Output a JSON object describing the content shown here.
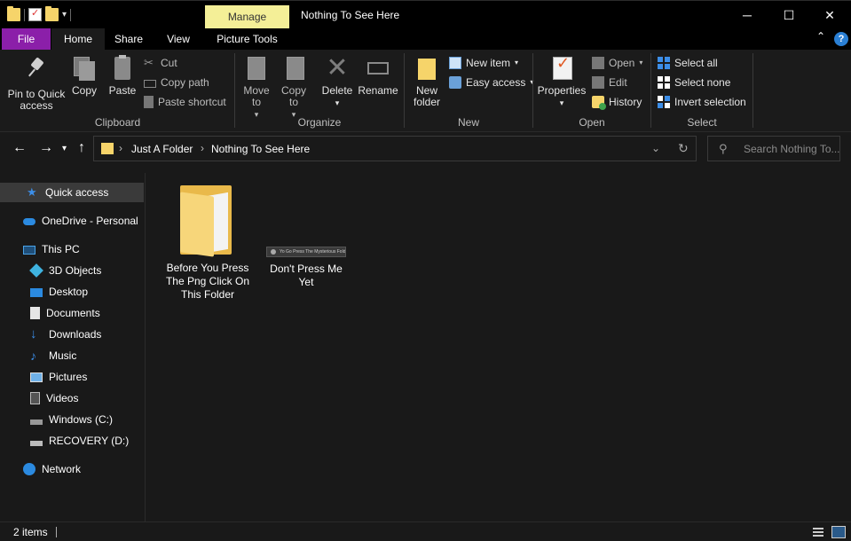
{
  "window": {
    "title": "Nothing To See Here",
    "contextual_tab": "Manage",
    "minimize": "─",
    "maximize": "☐",
    "close": "✕"
  },
  "tabs": {
    "file": "File",
    "home": "Home",
    "share": "Share",
    "view": "View",
    "picture_tools": "Picture Tools",
    "help": "?",
    "collapse": "⌃"
  },
  "ribbon": {
    "clipboard": {
      "label": "Clipboard",
      "pin": "Pin to Quick access",
      "copy": "Copy",
      "paste": "Paste",
      "cut": "Cut",
      "copy_path": "Copy path",
      "paste_shortcut": "Paste shortcut"
    },
    "organize": {
      "label": "Organize",
      "move_to": "Move to",
      "copy_to": "Copy to",
      "delete": "Delete",
      "rename": "Rename"
    },
    "new": {
      "label": "New",
      "new_folder": "New folder",
      "new_item": "New item",
      "easy_access": "Easy access"
    },
    "open": {
      "label": "Open",
      "properties": "Properties",
      "open": "Open",
      "edit": "Edit",
      "history": "History"
    },
    "select": {
      "label": "Select",
      "select_all": "Select all",
      "select_none": "Select none",
      "invert_selection": "Invert selection"
    }
  },
  "address": {
    "crumbs": [
      "Just A Folder",
      "Nothing To See Here"
    ],
    "search_placeholder": "Search Nothing To..."
  },
  "nav": {
    "quick_access": "Quick access",
    "onedrive": "OneDrive - Personal",
    "this_pc": "This PC",
    "objects3d": "3D Objects",
    "desktop": "Desktop",
    "documents": "Documents",
    "downloads": "Downloads",
    "music": "Music",
    "pictures": "Pictures",
    "videos": "Videos",
    "windows_c": "Windows (C:)",
    "recovery_d": "RECOVERY (D:)",
    "network": "Network"
  },
  "files": [
    {
      "name": "Before You Press The Png Click On This Folder",
      "type": "folder"
    },
    {
      "name": "Don't Press Me Yet",
      "type": "png",
      "thumb_text": "Yo Go Press The Mysterious Folder"
    }
  ],
  "status": {
    "count": "2 items"
  }
}
